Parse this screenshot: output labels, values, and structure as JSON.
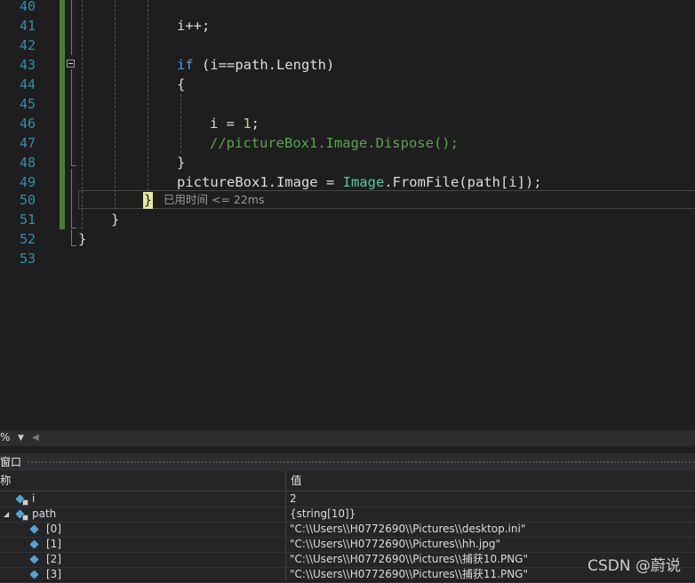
{
  "editor": {
    "line_numbers": [
      "40",
      "41",
      "42",
      "43",
      "44",
      "45",
      "46",
      "47",
      "48",
      "49",
      "50",
      "51",
      "52",
      "53"
    ],
    "lines": {
      "l41_code": "i++;",
      "l43_kw": "if",
      "l43_rest": " (i==path.Length)",
      "l44_code": "{",
      "l46_var": "i = ",
      "l46_num": "1",
      "l46_end": ";",
      "l47_comment": "//pictureBox1.Image.Dispose();",
      "l48_code": "}",
      "l49_a": "pictureBox1.Image = ",
      "l49_type": "Image",
      "l49_b": ".FromFile(path[i]);",
      "l50_brace": "}",
      "l51_code": "}",
      "l52_code": "}"
    },
    "perf_tip": "已用时间 <= 22ms",
    "colors": {
      "keyword": "#569cd6",
      "type": "#4ec9b0",
      "number": "#b5cea8",
      "comment": "#57a64a",
      "line_number": "#2b91af"
    }
  },
  "statusbar": {
    "zoom": "%",
    "zoom_dropdown_icon": "chevron-down-icon",
    "scroll_left_icon": "triangle-left-icon"
  },
  "watch": {
    "title": "窗口",
    "columns": {
      "name": "称",
      "value": "值"
    },
    "rows": [
      {
        "name": "i",
        "value": "2"
      },
      {
        "name": "path",
        "value": "{string[10]}"
      },
      {
        "name": "[0]",
        "value": "\"C:\\\\Users\\\\H0772690\\\\Pictures\\\\desktop.ini\""
      },
      {
        "name": "[1]",
        "value": "\"C:\\\\Users\\\\H0772690\\\\Pictures\\\\hh.jpg\""
      },
      {
        "name": "[2]",
        "value": "\"C:\\\\Users\\\\H0772690\\\\Pictures\\\\捕获10.PNG\""
      },
      {
        "name": "[3]",
        "value": "\"C:\\\\Users\\\\H0772690\\\\Pictures\\\\捕获11.PNG\""
      }
    ]
  },
  "watermark": "CSDN @蔚说"
}
